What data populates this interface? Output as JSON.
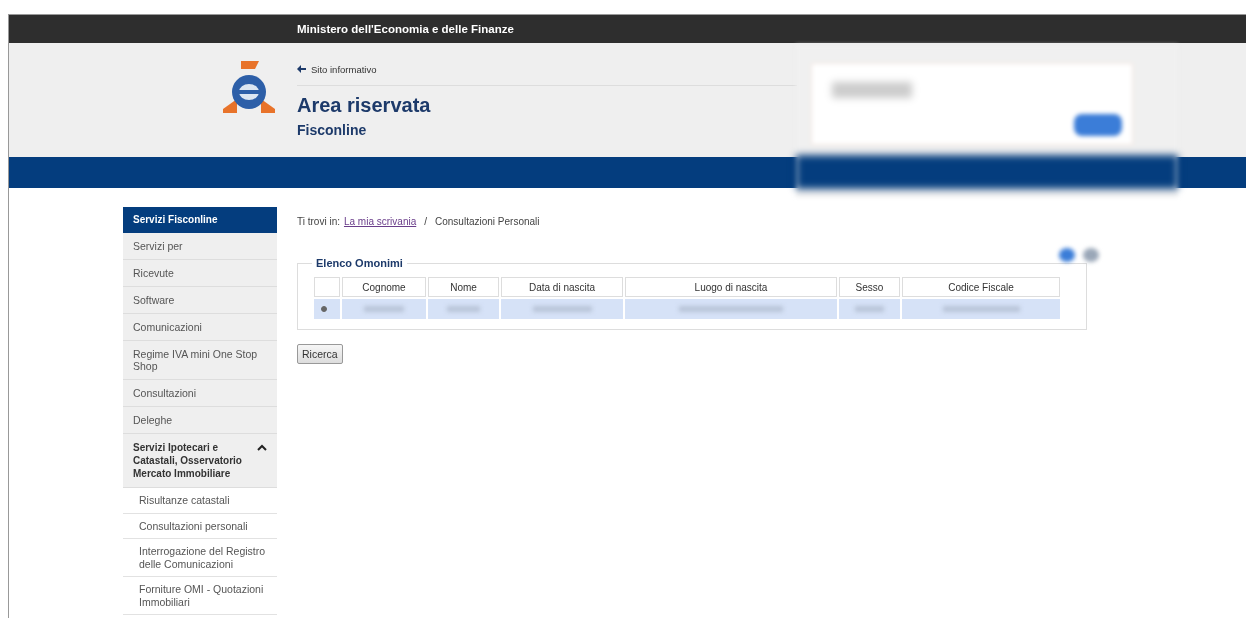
{
  "top_bar": {
    "title": "Ministero dell'Economia e delle Finanze"
  },
  "header": {
    "back_link": "Sito informativo",
    "title": "Area riservata",
    "subtitle": "Fisconline"
  },
  "sidebar": {
    "heading": "Servizi Fisconline",
    "items": [
      {
        "label": "Servizi per",
        "kind": "link"
      },
      {
        "label": "Ricevute",
        "kind": "link"
      },
      {
        "label": "Software",
        "kind": "link"
      },
      {
        "label": "Comunicazioni",
        "kind": "link"
      },
      {
        "label": "Regime IVA mini One Stop Shop",
        "kind": "link"
      },
      {
        "label": "Consultazioni",
        "kind": "link"
      },
      {
        "label": "Deleghe",
        "kind": "link"
      },
      {
        "label": "Servizi Ipotecari e Catastali, Osservatorio Mercato Immobiliare",
        "kind": "section",
        "expanded": true,
        "children": [
          {
            "label": "Risultanze catastali"
          },
          {
            "label": "Consultazioni personali"
          },
          {
            "label": "Interrogazione del Registro delle Comunicazioni"
          },
          {
            "label": "Forniture OMI - Quotazioni Immobiliari"
          }
        ]
      }
    ]
  },
  "breadcrumb": {
    "prefix": "Ti trovi in:",
    "link": "La mia scrivania",
    "separator": "/",
    "current": "Consultazioni Personali"
  },
  "results": {
    "legend": "Elenco Omonimi",
    "columns": [
      "Cognome",
      "Nome",
      "Data di nascita",
      "Luogo di nascita",
      "Sesso",
      "Codice Fiscale"
    ],
    "rows": [
      {
        "selected": true
      }
    ]
  },
  "search_button": "Ricerca"
}
